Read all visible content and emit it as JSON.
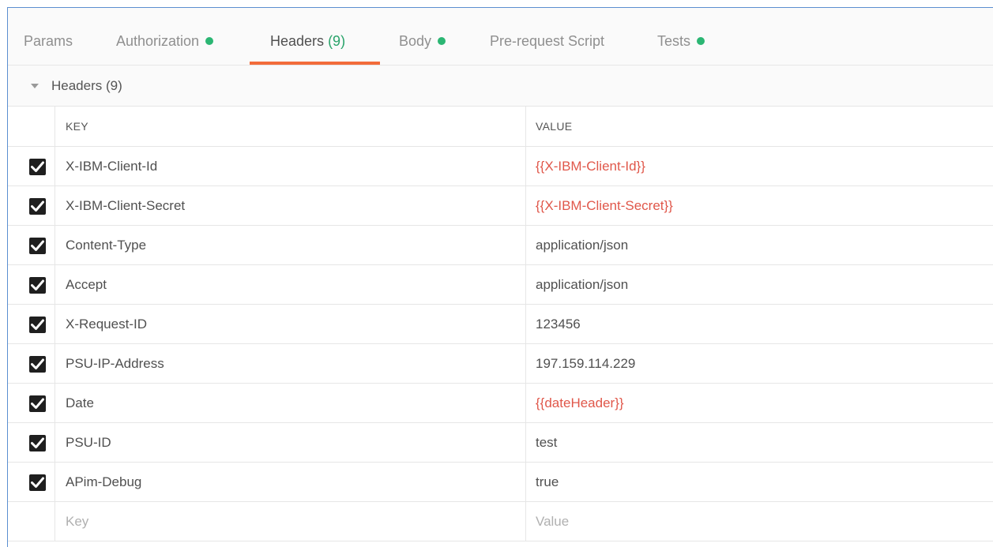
{
  "tabs": [
    {
      "label": "Params",
      "count": "",
      "dot": false
    },
    {
      "label": "Authorization",
      "count": "",
      "dot": true
    },
    {
      "label": "Headers",
      "count": "(9)",
      "dot": false,
      "active": true
    },
    {
      "label": "Body",
      "count": "",
      "dot": true
    },
    {
      "label": "Pre-request Script",
      "count": "",
      "dot": false
    },
    {
      "label": "Tests",
      "count": "",
      "dot": true
    }
  ],
  "colors": {
    "dot": "#2bb673",
    "active_underline": "#f26b3a",
    "variable": "#e0574a"
  },
  "section": {
    "title": "Headers (9)",
    "expanded": true
  },
  "table": {
    "columns": {
      "key": "KEY",
      "value": "VALUE"
    },
    "rows": [
      {
        "checked": true,
        "key": "X-IBM-Client-Id",
        "value": "{{X-IBM-Client-Id}}",
        "is_variable": true
      },
      {
        "checked": true,
        "key": "X-IBM-Client-Secret",
        "value": "{{X-IBM-Client-Secret}}",
        "is_variable": true
      },
      {
        "checked": true,
        "key": "Content-Type",
        "value": "application/json",
        "is_variable": false
      },
      {
        "checked": true,
        "key": "Accept",
        "value": "application/json",
        "is_variable": false
      },
      {
        "checked": true,
        "key": "X-Request-ID",
        "value": "123456",
        "is_variable": false
      },
      {
        "checked": true,
        "key": "PSU-IP-Address",
        "value": "197.159.114.229",
        "is_variable": false
      },
      {
        "checked": true,
        "key": "Date",
        "value": "{{dateHeader}}",
        "is_variable": true
      },
      {
        "checked": true,
        "key": "PSU-ID",
        "value": "test",
        "is_variable": false
      },
      {
        "checked": true,
        "key": "APim-Debug",
        "value": "true",
        "is_variable": false
      }
    ],
    "new_row": {
      "key_placeholder": "Key",
      "value_placeholder": "Value"
    }
  }
}
